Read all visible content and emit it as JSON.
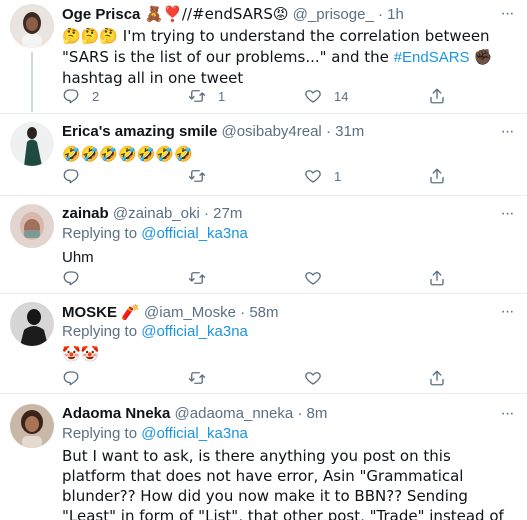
{
  "tweets": [
    {
      "name": "Oge Prisca",
      "name_suffix": "🧸❣️//#endSARS😡",
      "handle": "@_prisoge_",
      "time": "1h",
      "reply_label": "",
      "reply_to": "",
      "text_before": "🤔🤔🤔 I'm trying to understand the correlation between \"SARS is the list of our problems...\" and the ",
      "hashtag": "#EndSARS",
      "text_after": "✊🏿 hashtag all in one tweet",
      "replies": "2",
      "retweets": "1",
      "likes": "14"
    },
    {
      "name": "Erica's amazing smile",
      "handle": "@osibaby4real",
      "time": "31m",
      "text": "🤣🤣🤣🤣🤣🤣🤣",
      "replies": "",
      "retweets": "",
      "likes": "1"
    },
    {
      "name": "zainab",
      "handle": "@zainab_oki",
      "time": "27m",
      "reply_label": "Replying to ",
      "reply_to": "@official_ka3na",
      "text": "Uhm",
      "replies": "",
      "retweets": "",
      "likes": ""
    },
    {
      "name": "MOSKE",
      "name_suffix": "🧨",
      "handle": "@iam_Moske",
      "time": "58m",
      "reply_label": "Replying to ",
      "reply_to": "@official_ka3na",
      "text": "🤡🤡",
      "replies": "",
      "retweets": "",
      "likes": ""
    },
    {
      "name": "Adaoma Nneka",
      "handle": "@adaoma_nneka",
      "time": "8m",
      "reply_label": "Replying to ",
      "reply_to": "@official_ka3na",
      "text": "But I want to ask, is there anything you post on this platform that does not have error, Asin \"Grammatical blunder?? How did you now make it to BBN?? Sending \"Least\" in form of \"List\", that other post, \"Trade\" instead of \"tread\", \"Course\" instead of \"Cause\" gush🤦"
    }
  ],
  "ui": {
    "dot": "·",
    "more": "···"
  },
  "colors": {
    "accent": "#1b95e0",
    "muted": "#5b7083",
    "separator": "#e6ecf0"
  }
}
